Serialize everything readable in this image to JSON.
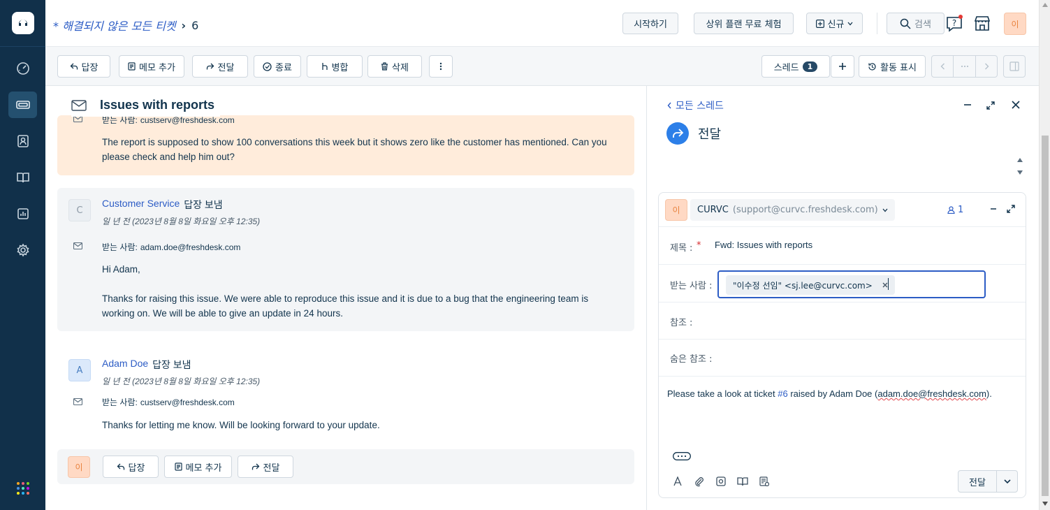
{
  "nav": {
    "items": [
      "dashboard",
      "tickets",
      "contacts",
      "knowledge-base",
      "reports",
      "admin"
    ],
    "active": "tickets"
  },
  "header": {
    "breadcrumb_title": "* 해결되지 않은 모든 티켓",
    "breadcrumb_count": "6",
    "get_started_label": "시작하기",
    "trial_label": "상위 플랜 무료 체험",
    "new_label": "신규",
    "search_label": "검색",
    "avatar_initial": "이"
  },
  "toolbar": {
    "reply_label": "답장",
    "add_note_label": "메모 추가",
    "forward_label": "전달",
    "close_label": "종료",
    "merge_label": "병합",
    "delete_label": "삭제",
    "threads_label": "스레드",
    "threads_count": "1",
    "activity_label": "활동 표시"
  },
  "conversation": {
    "subject": "Issues with reports",
    "messages": [
      {
        "to_label": "받는 사람:",
        "to_email": "custserv@freshdesk.com",
        "body": "The report is supposed to show 100 conversations this week but it shows zero like the customer has mentioned. Can you please check and help him out?"
      },
      {
        "avatar": "C",
        "sender": "Customer Service",
        "action": "답장 보냄",
        "time": "일 년 전 (2023년 8월 8일 화요일 오후 12:35)",
        "to_label": "받는 사람:",
        "to_email": "adam.doe@freshdesk.com",
        "greeting": "Hi Adam,",
        "body": "Thanks for raising this issue. We were able to reproduce this issue and it is due to a bug that the engineering team is working on. We will be able to give an update in 24 hours."
      },
      {
        "avatar": "A",
        "sender": "Adam Doe",
        "action": "답장 보냄",
        "time": "일 년 전 (2023년 8월 8일 화요일 오후 12:35)",
        "to_label": "받는 사람:",
        "to_email": "custserv@freshdesk.com",
        "body": "Thanks for letting me know. Will be looking forward to your update."
      }
    ],
    "reply_bar": {
      "avatar": "이",
      "reply_label": "답장",
      "note_label": "메모 추가",
      "forward_label": "전달"
    }
  },
  "forward_pane": {
    "back_label": "모든 스레드",
    "title": "전달",
    "composer": {
      "avatar": "이",
      "from_name": "CURVC",
      "from_email": "(support@curvc.freshdesk.com)",
      "agent_count": "1",
      "subject_label": "제목 :",
      "required_mark": "*",
      "subject_value": "Fwd: Issues with reports",
      "to_label": "받는 사람 :",
      "to_chip_name": "\"이수정 선임\"",
      "to_chip_email": "<sj.lee@curvc.com>",
      "cc_label": "참조 :",
      "bcc_label": "숨은 참조 :",
      "body_prefix": "Please take a look at ticket ",
      "body_ticket": "#6",
      "body_middle": " raised by Adam Doe (",
      "body_email": "adam.doe@freshdesk.com",
      "body_suffix": ").",
      "send_label": "전달"
    }
  },
  "colors": {
    "nav_bg": "#11304a",
    "link_blue": "#2c5cc5",
    "highlight_orange": "#ffecdb",
    "avatar_bg": "#ffd9c4",
    "forward_circle": "#2c7fe8"
  }
}
